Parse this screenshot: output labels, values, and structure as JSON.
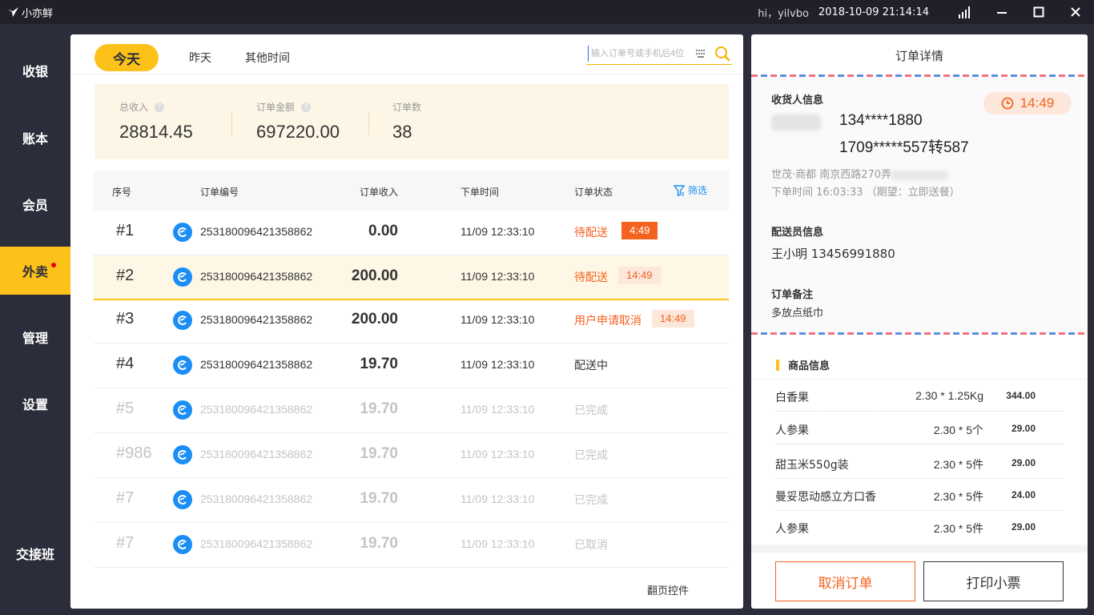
{
  "app": {
    "logo": "小亦鲜"
  },
  "titlebar": {
    "greeting": "hi，yilvbo",
    "datetime": "2018-10-09 21:14:14"
  },
  "sidebar": {
    "items": [
      {
        "label": "收银"
      },
      {
        "label": "账本"
      },
      {
        "label": "会员"
      },
      {
        "label": "外卖",
        "active": true,
        "has_dot": true
      },
      {
        "label": "管理"
      },
      {
        "label": "设置"
      }
    ],
    "bottom": {
      "label": "交接班"
    }
  },
  "orders": {
    "tabs": [
      {
        "label": "今天",
        "active": true
      },
      {
        "label": "昨天"
      },
      {
        "label": "其他时间"
      }
    ],
    "search": {
      "placeholder": "输入订单号或手机后4位"
    },
    "summary": {
      "total_income": {
        "label": "总收入",
        "value": "28814.45"
      },
      "order_amount": {
        "label": "订单金额",
        "value": "697220.00"
      },
      "order_count": {
        "label": "订单数",
        "value": "38"
      }
    },
    "columns": {
      "seq": "序号",
      "orderno": "订单编号",
      "income": "订单收入",
      "time": "下单时间",
      "status": "订单状态",
      "filter": "筛选"
    },
    "rows": [
      {
        "seq": "#1",
        "orderno": "253180096421358862",
        "income": "0.00",
        "time": "11/09 12:33:10",
        "status": "待配送",
        "badge": "4:49"
      },
      {
        "seq": "#2",
        "orderno": "253180096421358862",
        "income": "200.00",
        "time": "11/09 12:33:10",
        "status": "待配送",
        "badge": "14:49"
      },
      {
        "seq": "#3",
        "orderno": "253180096421358862",
        "income": "200.00",
        "time": "11/09 12:33:10",
        "status": "用户申请取消",
        "badge": "14:49"
      },
      {
        "seq": "#4",
        "orderno": "253180096421358862",
        "income": "19.70",
        "time": "11/09 12:33:10",
        "status": "配送中"
      },
      {
        "seq": "#5",
        "orderno": "253180096421358862",
        "income": "19.70",
        "time": "11/09 12:33:10",
        "status": "已完成"
      },
      {
        "seq": "#986",
        "orderno": "253180096421358862",
        "income": "19.70",
        "time": "11/09 12:33:10",
        "status": "已完成"
      },
      {
        "seq": "#7",
        "orderno": "253180096421358862",
        "income": "19.70",
        "time": "11/09 12:33:10",
        "status": "已完成"
      },
      {
        "seq": "#7",
        "orderno": "253180096421358862",
        "income": "19.70",
        "time": "11/09 12:33:10",
        "status": "已取消"
      }
    ],
    "pager": "翻页控件"
  },
  "detail": {
    "title": "订单详情",
    "recipient_label": "收货人信息",
    "countdown": "14:49",
    "phone1": "134****1880",
    "phone2": "1709*****557转587",
    "address": "世茂·商都  南京西路270弄",
    "order_time": "下单时间  16:03:33 （期望：立即送餐）",
    "courier_label": "配送员信息",
    "courier": "王小明    13456991880",
    "remark_label": "订单备注",
    "remark": "多放点纸巾",
    "goods_label": "商品信息",
    "goods": [
      {
        "name": "白香果",
        "qty": "2.30 * 1.25Kg",
        "price": "344.00"
      },
      {
        "name": "人参果",
        "qty": "2.30 * 5个",
        "price": "29.00"
      },
      {
        "name": "甜玉米550g装",
        "qty": "2.30 * 5件",
        "price": "29.00"
      },
      {
        "name": "曼妥思动感立方口香",
        "qty": "2.30 * 5件",
        "price": "24.00"
      },
      {
        "name": "人参果",
        "qty": "2.30 * 5件",
        "price": "29.00"
      }
    ],
    "cancel_button": "取消订单",
    "print_button": "打印小票"
  },
  "colors": {
    "accent": "#fdc21a",
    "warning": "#f4621f",
    "sidebar": "#2b2d3a",
    "link": "#1a8ef5"
  }
}
